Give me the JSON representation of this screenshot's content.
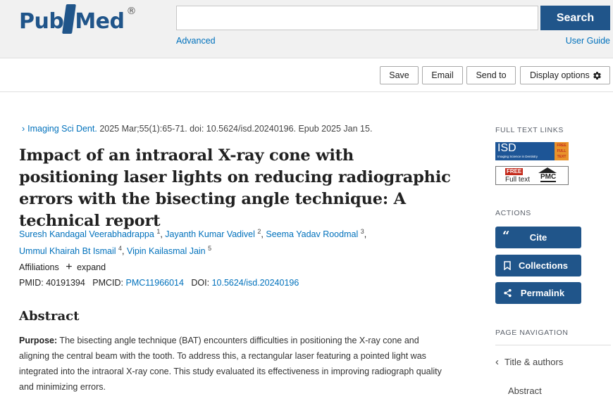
{
  "header": {
    "logo_text_left": "Pub",
    "logo_text_right": "Med",
    "logo_reg": "®",
    "search_placeholder": "",
    "search_button": "Search",
    "advanced_link": "Advanced",
    "user_guide_link": "User Guide"
  },
  "toolbar": {
    "save": "Save",
    "email": "Email",
    "send_to": "Send to",
    "display_options": "Display options"
  },
  "article": {
    "journal_link": "Imaging Sci Dent.",
    "citation_rest": " 2025 Mar;55(1):65-71. doi: 10.5624/isd.20240196. Epub 2025 Jan 15.",
    "title": "Impact of an intraoral X-ray cone with positioning laser lights on reducing radiographic errors with the bisecting angle technique: A technical report",
    "authors": [
      {
        "name": "Suresh Kandagal Veerabhadrappa",
        "sup": "1"
      },
      {
        "name": "Jayanth Kumar Vadivel",
        "sup": "2"
      },
      {
        "name": "Seema Yadav Roodmal",
        "sup": "3"
      },
      {
        "name": "Ummul Khairah Bt Ismail",
        "sup": "4"
      },
      {
        "name": "Vipin Kailasmal Jain",
        "sup": "5"
      }
    ],
    "affiliations_label": "Affiliations",
    "expand_label": "expand",
    "pmid_label": "PMID:",
    "pmid": "40191394",
    "pmcid_label": "PMCID:",
    "pmcid": "PMC11966014",
    "doi_label": "DOI:",
    "doi": "10.5624/isd.20240196",
    "abstract_heading": "Abstract",
    "purpose_label": "Purpose:",
    "purpose_text": " The bisecting angle technique (BAT) encounters difficulties in positioning the X-ray cone and aligning the central beam with the tooth. To address this, a rectangular laser featuring a pointed light was integrated into the intraoral X-ray cone. This study evaluated its effectiveness in improving radiograph quality and minimizing errors."
  },
  "sidebar": {
    "full_text_links_label": "FULL TEXT LINKS",
    "isd_badge_text": "ISD",
    "isd_badge_sub": "Imaging Science in Dentistry",
    "isd_free_lines": [
      "FREE",
      "FULL",
      "TEXT"
    ],
    "pmc_free": "FREE",
    "pmc_full_text": "Full text",
    "pmc_label": "PMC",
    "actions_label": "ACTIONS",
    "cite": "Cite",
    "collections": "Collections",
    "permalink": "Permalink",
    "page_nav_label": "PAGE NAVIGATION",
    "nav_title_authors": "Title & authors",
    "nav_abstract": "Abstract"
  },
  "colors": {
    "brand_blue": "#20558a",
    "link_blue": "#0071bc"
  }
}
